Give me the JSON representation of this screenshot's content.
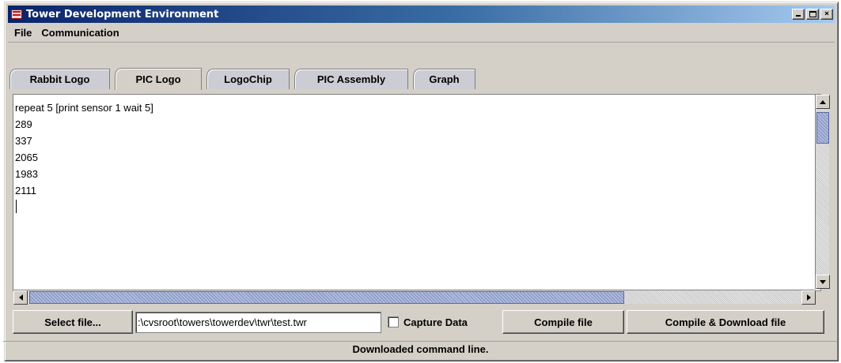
{
  "window": {
    "title": "Tower Development Environment",
    "icon": "tower-app-icon"
  },
  "window_controls": {
    "minimize_icon": "minimize-icon",
    "maximize_icon": "maximize-icon",
    "close_icon": "close-icon",
    "close_glyph": "×"
  },
  "menu": {
    "items": [
      {
        "label": "File"
      },
      {
        "label": "Communication"
      }
    ]
  },
  "tabs": [
    {
      "label": "Rabbit Logo",
      "active": false
    },
    {
      "label": "PIC Logo",
      "active": true
    },
    {
      "label": "LogoChip",
      "active": false
    },
    {
      "label": "PIC Assembly",
      "active": false
    },
    {
      "label": "Graph",
      "active": false
    }
  ],
  "editor": {
    "lines": [
      "repeat 5 [print sensor 1 wait 5]",
      "289",
      "337",
      "2065",
      "1983",
      "2111"
    ]
  },
  "controls": {
    "select_file_label": "Select file...",
    "file_path_value": ":\\cvsroot\\towers\\towerdev\\twr\\test.twr",
    "capture_data_label": "Capture Data",
    "capture_data_checked": false,
    "compile_file_label": "Compile file",
    "compile_download_label": "Compile & Download file"
  },
  "status": {
    "text": "Downloaded command line."
  },
  "colors": {
    "title_start": "#0a246a",
    "title_end": "#a6caf0",
    "window_bg": "#d4d0c8",
    "scroll_thumb": "#9aa6c8"
  }
}
